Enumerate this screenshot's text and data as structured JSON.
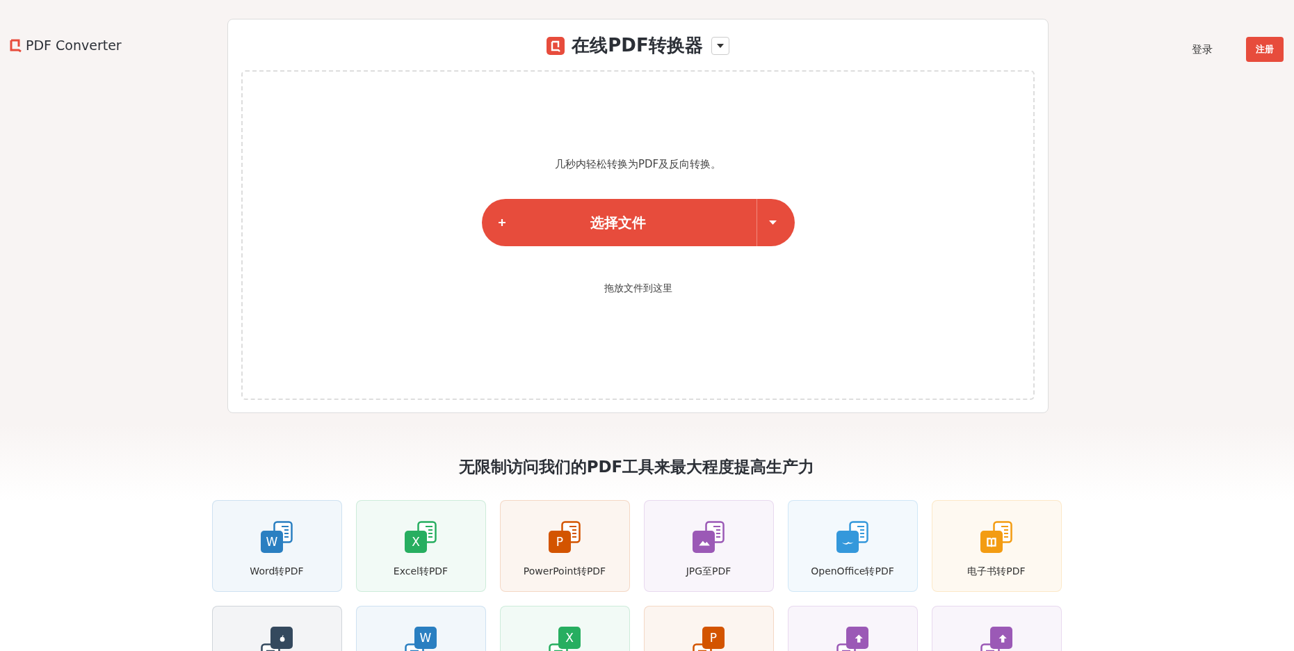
{
  "brand": {
    "name": "PDF Converter"
  },
  "header": {
    "title": "在线PDF转换器",
    "login": "登录",
    "register": "注册"
  },
  "upload": {
    "subtitle": "几秒内轻松转换为PDF及反向转换。",
    "button": "选择文件",
    "drop_hint": "拖放文件到这里"
  },
  "tools": {
    "heading": "无限制访问我们的PDF工具来最大程度提高生产力",
    "cards": [
      {
        "kind": "letter",
        "from_pdf": false,
        "glyph": "W",
        "color": "#2a7fc1",
        "label": "Word转PDF"
      },
      {
        "kind": "letter",
        "from_pdf": false,
        "glyph": "X",
        "color": "#27ae60",
        "label": "Excel转PDF"
      },
      {
        "kind": "letter",
        "from_pdf": false,
        "glyph": "P",
        "color": "#d35400",
        "label": "PowerPoint转PDF"
      },
      {
        "kind": "image",
        "from_pdf": false,
        "color": "#9b59b6",
        "label": "JPG至PDF"
      },
      {
        "kind": "bird",
        "from_pdf": false,
        "color": "#3498db",
        "label": "OpenOffice转PDF"
      },
      {
        "kind": "book",
        "from_pdf": false,
        "color": "#f39c12",
        "label": "电子书转PDF"
      },
      {
        "kind": "apple",
        "from_pdf": true,
        "color": "#34495e"
      },
      {
        "kind": "letter",
        "from_pdf": true,
        "glyph": "W",
        "color": "#2a7fc1"
      },
      {
        "kind": "letter",
        "from_pdf": true,
        "glyph": "X",
        "color": "#27ae60"
      },
      {
        "kind": "letter",
        "from_pdf": true,
        "glyph": "P",
        "color": "#d35400"
      },
      {
        "kind": "arrow",
        "from_pdf": true,
        "color": "#9b59b6"
      },
      {
        "kind": "arrow",
        "from_pdf": true,
        "color": "#9b59b6"
      }
    ]
  }
}
